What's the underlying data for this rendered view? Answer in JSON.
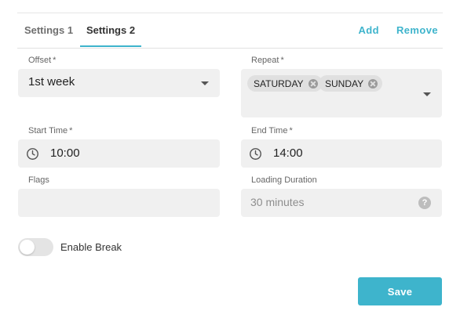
{
  "tabs": [
    {
      "label": "Settings 1",
      "active": false
    },
    {
      "label": "Settings 2",
      "active": true
    }
  ],
  "actions": {
    "add_label": "Add",
    "remove_label": "Remove"
  },
  "accent_color": "#3eb4cc",
  "fields": {
    "offset": {
      "label": "Offset",
      "required_mark": "*",
      "value": "1st week"
    },
    "repeat": {
      "label": "Repeat",
      "required_mark": "*",
      "chips": [
        "SATURDAY",
        "SUNDAY"
      ]
    },
    "start_time": {
      "label": "Start Time",
      "required_mark": "*",
      "value": "10:00",
      "icon": "clock-icon"
    },
    "end_time": {
      "label": "End Time",
      "required_mark": "*",
      "value": "14:00",
      "icon": "clock-icon"
    },
    "flags": {
      "label": "Flags",
      "value": ""
    },
    "loading_duration": {
      "label": "Loading Duration",
      "value": "30 minutes",
      "icon": "help-icon",
      "help_glyph": "?"
    }
  },
  "break_toggle": {
    "label": "Enable Break",
    "on": false
  },
  "save_label": "Save"
}
